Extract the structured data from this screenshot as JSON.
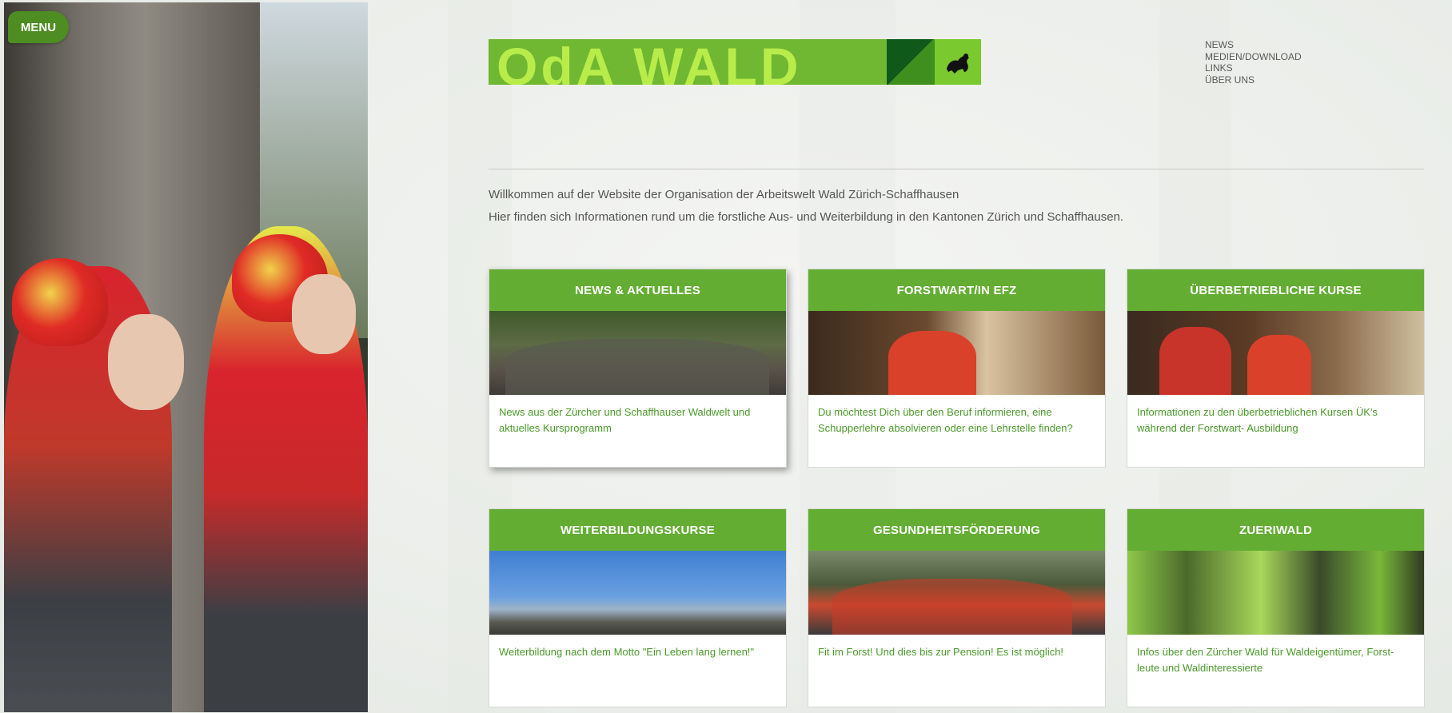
{
  "menu": {
    "label": "MENU"
  },
  "logo": {
    "text": "OdA WALD"
  },
  "topnav": {
    "items": [
      "NEWS",
      "MEDIEN/DOWNLOAD",
      "LINKS",
      "ÜBER UNS"
    ]
  },
  "intro": {
    "line1": "Willkommen auf der Website der Organisation der Arbeitswelt Wald Zürich-Schaffhausen",
    "line2": "Hier finden sich Informationen rund um die forstliche Aus- und Weiterbildung in den Kantonen Zürich und Schaffhausen."
  },
  "cards": [
    {
      "title": "NEWS & AKTUELLES",
      "text": "News aus der Zürcher und Schaffhauser Waldwelt und aktuelles Kursprogramm"
    },
    {
      "title": "FORSTWART/IN EFZ",
      "text": "Du möchtest Dich über den Beruf informieren, eine Schupperlehre absolvieren oder eine Lehrstelle finden?"
    },
    {
      "title": "ÜBERBETRIEBLICHE KURSE",
      "text": "Informationen zu den überbetrieblichen Kursen ÜK's während der Forstwart- Ausbildung"
    },
    {
      "title": "WEITERBILDUNGSKURSE",
      "text": "Weiterbildung nach dem Motto \"Ein Leben lang lernen!\""
    },
    {
      "title": "GESUNDHEITSFÖRDERUNG",
      "text": "Fit im Forst! Und dies bis zur Pension! Es ist möglich!"
    },
    {
      "title": "ZUERIWALD",
      "text": "Infos über den Zürcher Wald für Waldeigentümer, Forst-leute und Waldinteressierte"
    }
  ],
  "colors": {
    "accent_green": "#63ae32",
    "text_green": "#4a9a2a",
    "menu_green": "#4e8d22"
  }
}
